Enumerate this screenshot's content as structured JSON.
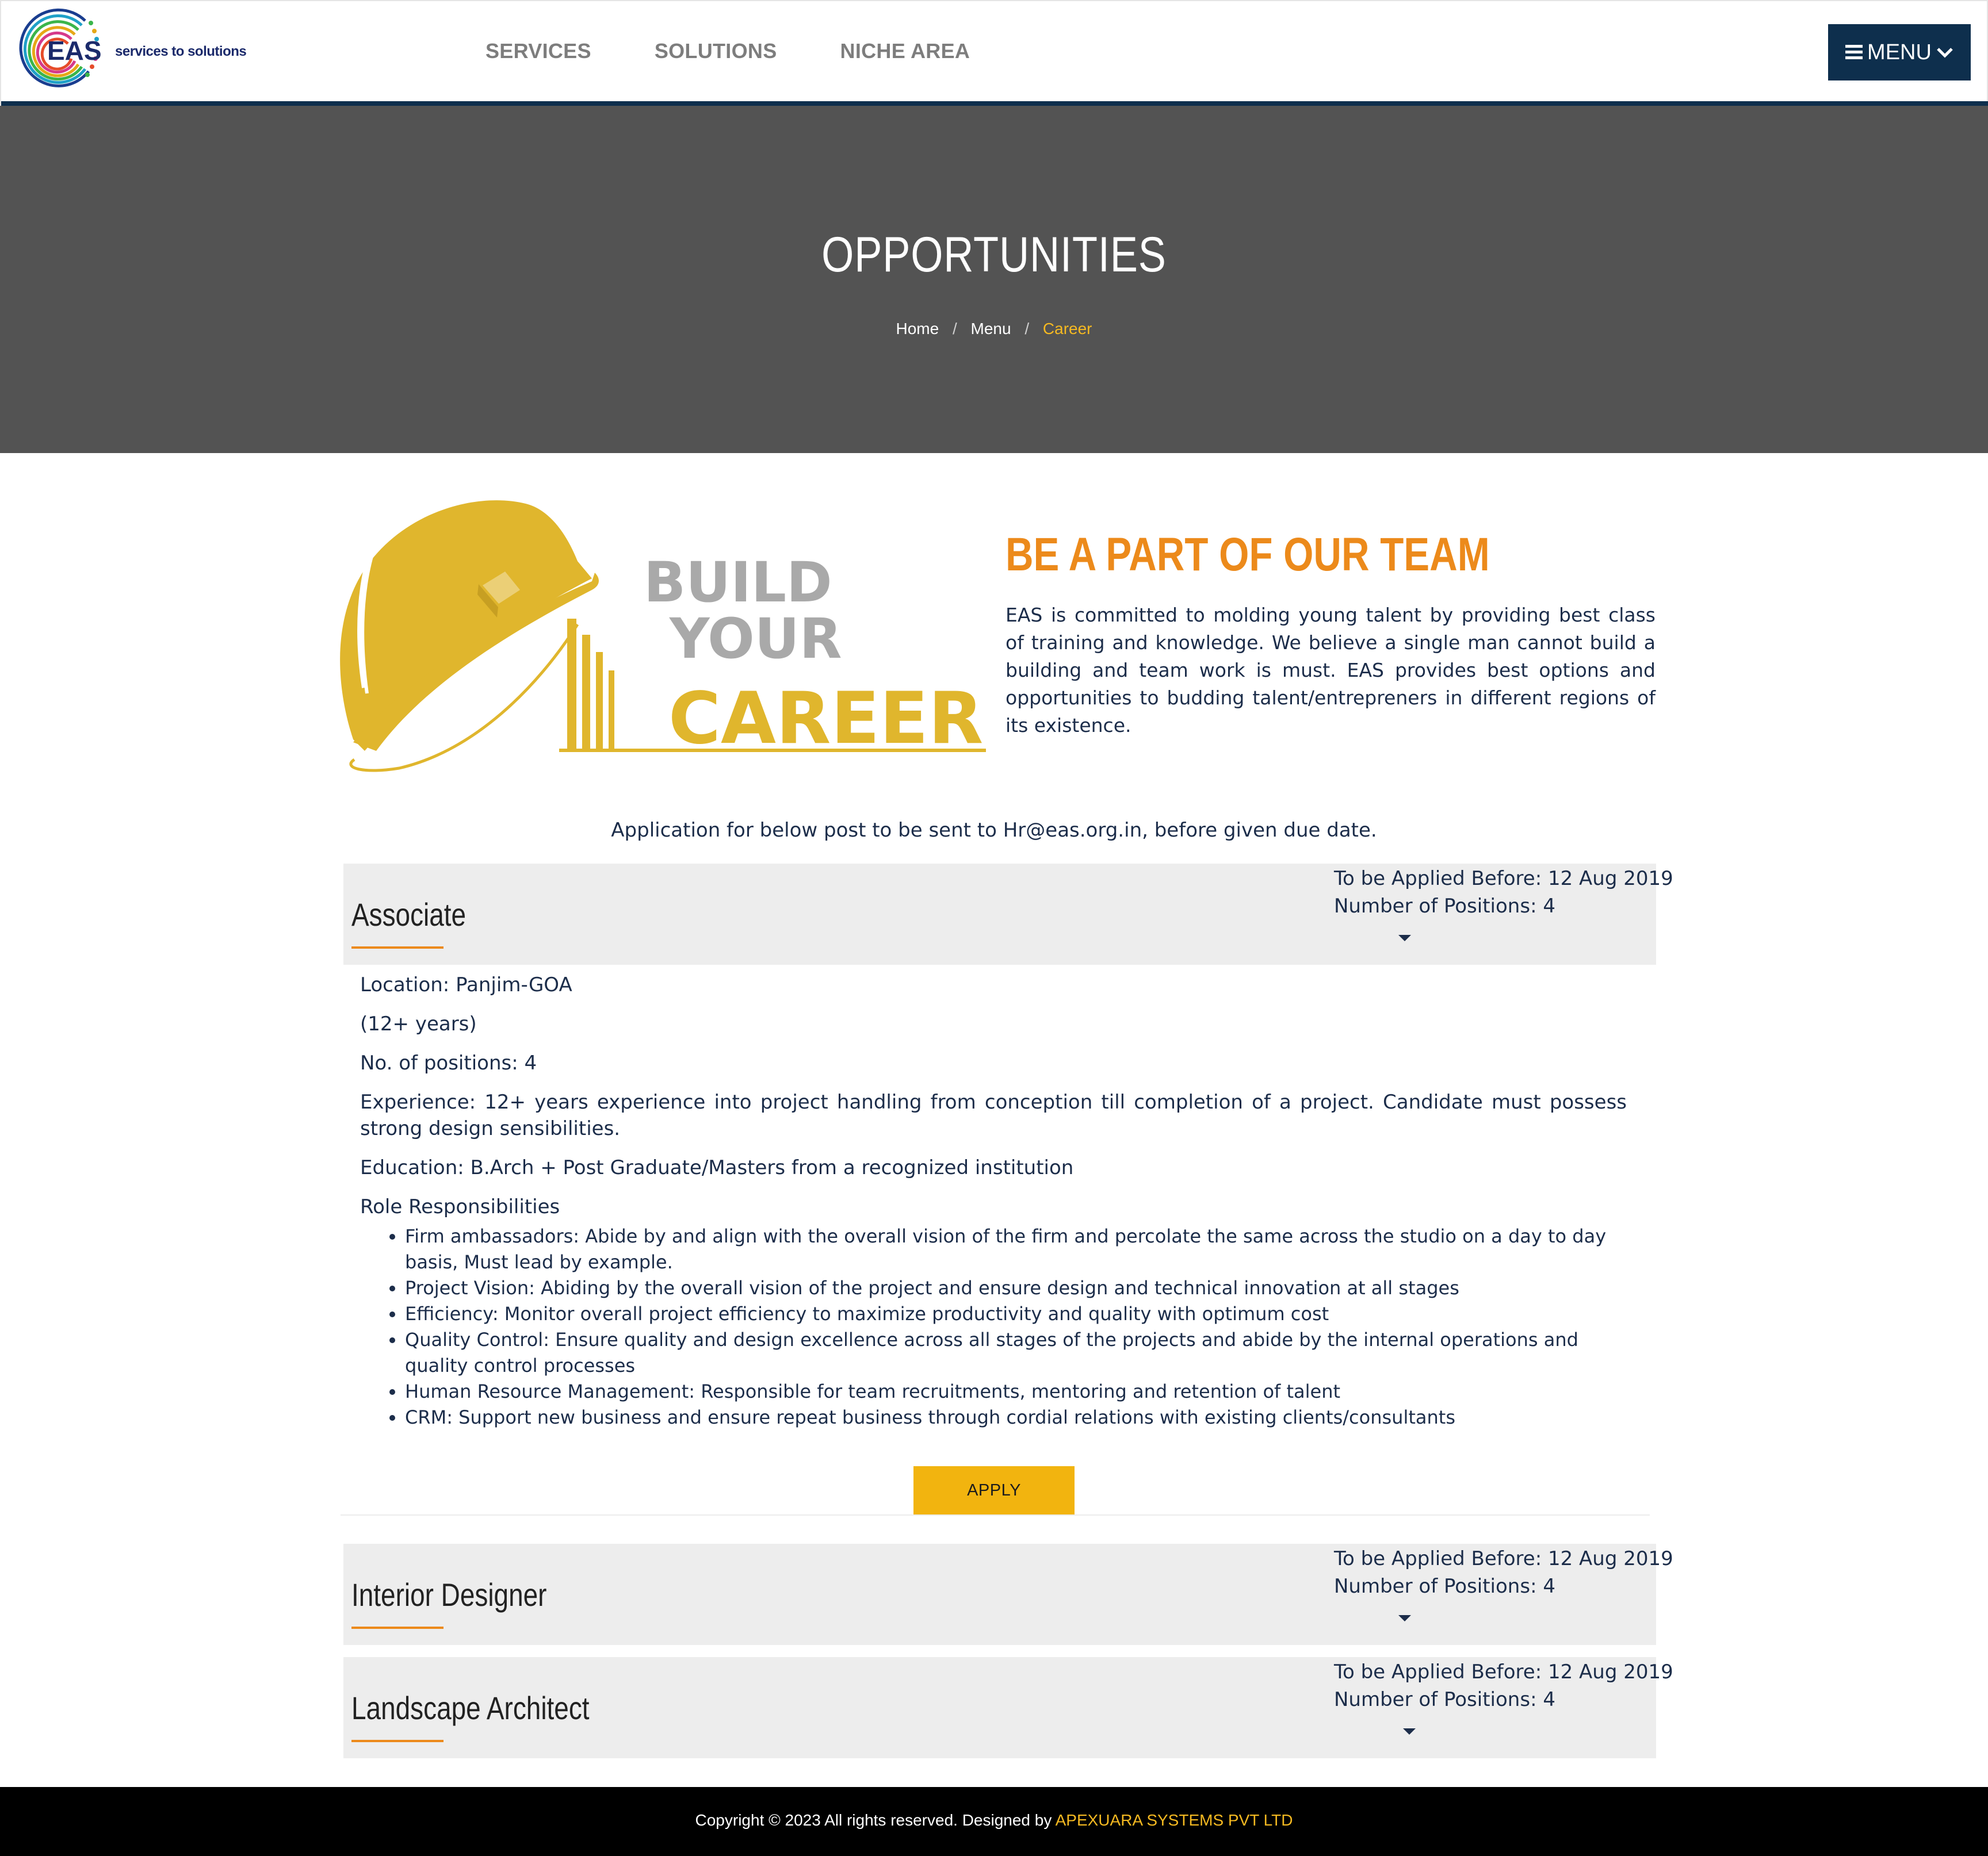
{
  "header": {
    "logo_text": "EAS",
    "tagline": "services to solutions",
    "nav": [
      "SERVICES",
      "SOLUTIONS",
      "NICHE AREA"
    ],
    "menu_label": "MENU",
    "colors": {
      "nav_bar": "#0e2f4d",
      "nav_text": "#7d7d7d"
    }
  },
  "hero": {
    "title": "OPPORTUNITIES",
    "breadcrumb": [
      "Home",
      "Menu",
      "Career"
    ],
    "separator": "/",
    "colors": {
      "background": "#535353",
      "active_crumb": "#f5b921"
    }
  },
  "intro": {
    "image_text": [
      "BUILD",
      "YOUR",
      "CAREER"
    ],
    "title": "BE A PART OF OUR TEAM",
    "text": "EAS is committed to molding young talent by providing best class of training and knowledge. We believe a single man cannot build a building and team work is must. EAS provides best options and opportunities to budding talent/entrepreners in different regions of its existence.",
    "colors": {
      "title": "#ec8a1b",
      "image_gold": "#e0b62d",
      "image_grey": "#a9a9a9"
    }
  },
  "apply_note": "Application for below post to be sent to Hr@eas.org.in, before given due date.",
  "jobs": [
    {
      "title": "Associate",
      "applied_before": "To be Applied Before: 12 Aug 2019",
      "positions": "Number of Positions: 4",
      "expanded": true,
      "details": {
        "location": "Location: Panjim-GOA",
        "years": "(12+ years)",
        "positions": "No. of positions: 4",
        "experience": "Experience: 12+ years experience into project handling from conception till completion of a project. Candidate must possess strong design sensibilities.",
        "education": "Education: B.Arch + Post Graduate/Masters from a recognized institution",
        "responsibilities_heading": "Role Responsibilities",
        "responsibilities": [
          "Firm ambassadors: Abide by and align with the overall vision of the firm and percolate the same across the studio on a day to day basis, Must lead by example.",
          "Project Vision: Abiding by the overall vision of the project and ensure design and technical innovation at all stages",
          "Efficiency: Monitor overall project efficiency to maximize productivity and quality with optimum cost",
          "Quality Control: Ensure quality and design excellence across all stages of the projects and abide by the internal operations and quality control processes",
          "Human Resource Management: Responsible for team recruitments, mentoring and retention of talent",
          "CRM: Support new business and ensure repeat business through cordial relations with existing clients/consultants"
        ],
        "apply_label": "APPLY"
      }
    },
    {
      "title": "Interior Designer",
      "applied_before": "To be Applied Before: 12 Aug 2019",
      "positions": "Number of Positions: 4",
      "expanded": false
    },
    {
      "title": "Landscape Architect",
      "applied_before": "To be Applied Before: 12 Aug 2019",
      "positions": "Number of Positions: 4",
      "expanded": false
    }
  ],
  "footer": {
    "copyright": "Copyright © 2023 All rights reserved. Designed by",
    "designer": "APEXUARA SYSTEMS PVT LTD",
    "colors": {
      "background": "#000000",
      "designer": "#f5b921"
    }
  },
  "icons": [
    "eas-logo-icon",
    "hamburger-icon",
    "chevron-down-icon",
    "helmet-icon",
    "caret-down-icon"
  ]
}
